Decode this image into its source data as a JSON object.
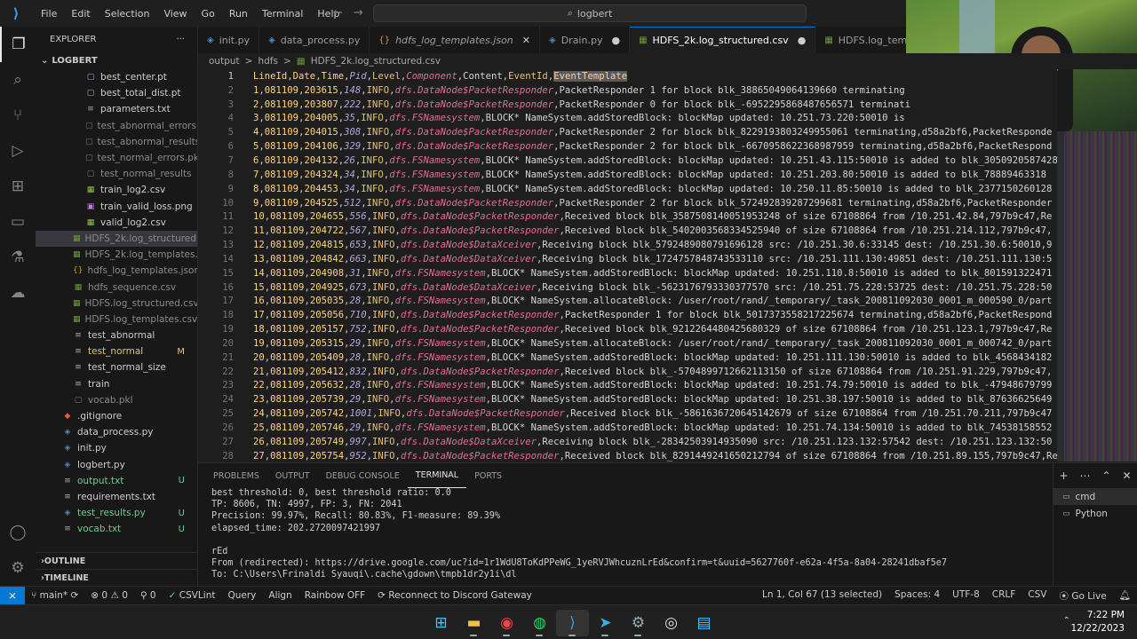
{
  "titlebar": {
    "menu": [
      "File",
      "Edit",
      "Selection",
      "View",
      "Go",
      "Run",
      "Terminal",
      "Help"
    ],
    "search": "logbert"
  },
  "explorer": {
    "header": "EXPLORER",
    "more": "···",
    "root": "LOGBERT",
    "items": [
      {
        "name": "best_center.pt",
        "indent": 2,
        "color": "#cccccc",
        "icon": "file-icon",
        "iconColor": "#9ab",
        "badge": ""
      },
      {
        "name": "best_total_dist.pt",
        "indent": 2,
        "color": "#cccccc",
        "icon": "file-icon",
        "iconColor": "#9ab",
        "badge": ""
      },
      {
        "name": "parameters.txt",
        "indent": 2,
        "color": "#cccccc",
        "icon": "text-file-icon",
        "iconColor": "#aaa",
        "badge": ""
      },
      {
        "name": "test_abnormal_errors.pkl",
        "indent": 2,
        "color": "#8b8b8b",
        "icon": "file-icon",
        "iconColor": "#777",
        "badge": ""
      },
      {
        "name": "test_abnormal_results",
        "indent": 2,
        "color": "#8b8b8b",
        "icon": "file-icon",
        "iconColor": "#777",
        "badge": ""
      },
      {
        "name": "test_normal_errors.pkl",
        "indent": 2,
        "color": "#8b8b8b",
        "icon": "file-icon",
        "iconColor": "#777",
        "badge": ""
      },
      {
        "name": "test_normal_results",
        "indent": 2,
        "color": "#8b8b8b",
        "icon": "file-icon",
        "iconColor": "#777",
        "badge": ""
      },
      {
        "name": "train_log2.csv",
        "indent": 2,
        "color": "#cccccc",
        "icon": "csv-icon",
        "iconColor": "#8bc34a",
        "badge": ""
      },
      {
        "name": "train_valid_loss.png",
        "indent": 2,
        "color": "#cccccc",
        "icon": "image-icon",
        "iconColor": "#c678dd",
        "badge": ""
      },
      {
        "name": "valid_log2.csv",
        "indent": 2,
        "color": "#cccccc",
        "icon": "csv-icon",
        "iconColor": "#8bc34a",
        "badge": ""
      },
      {
        "name": "HDFS_2k.log_structured.c...",
        "indent": 1,
        "color": "#8b8b8b",
        "icon": "csv-icon",
        "iconColor": "#6a9a3a",
        "badge": "",
        "selected": true
      },
      {
        "name": "HDFS_2k.log_templates.c...",
        "indent": 1,
        "color": "#8b8b8b",
        "icon": "csv-icon",
        "iconColor": "#6a9a3a",
        "badge": ""
      },
      {
        "name": "hdfs_log_templates.json",
        "indent": 1,
        "color": "#8b8b8b",
        "icon": "json-icon",
        "iconColor": "#c9a227",
        "badge": ""
      },
      {
        "name": "hdfs_sequence.csv",
        "indent": 1,
        "color": "#8b8b8b",
        "icon": "csv-icon",
        "iconColor": "#6a9a3a",
        "badge": ""
      },
      {
        "name": "HDFS.log_structured.csv",
        "indent": 1,
        "color": "#8b8b8b",
        "icon": "csv-icon",
        "iconColor": "#6a9a3a",
        "badge": ""
      },
      {
        "name": "HDFS.log_templates.csv",
        "indent": 1,
        "color": "#8b8b8b",
        "icon": "csv-icon",
        "iconColor": "#6a9a3a",
        "badge": ""
      },
      {
        "name": "test_abnormal",
        "indent": 1,
        "color": "#cccccc",
        "icon": "lines-icon",
        "iconColor": "#aaa",
        "badge": ""
      },
      {
        "name": "test_normal",
        "indent": 1,
        "color": "#e2c08d",
        "icon": "lines-icon",
        "iconColor": "#aaa",
        "badge": "M"
      },
      {
        "name": "test_normal_size",
        "indent": 1,
        "color": "#cccccc",
        "icon": "lines-icon",
        "iconColor": "#aaa",
        "badge": ""
      },
      {
        "name": "train",
        "indent": 1,
        "color": "#cccccc",
        "icon": "lines-icon",
        "iconColor": "#aaa",
        "badge": ""
      },
      {
        "name": "vocab.pkl",
        "indent": 1,
        "color": "#8b8b8b",
        "icon": "file-icon",
        "iconColor": "#777",
        "badge": ""
      },
      {
        "name": ".gitignore",
        "indent": 0,
        "color": "#cccccc",
        "icon": "git-icon",
        "iconColor": "#e8583a",
        "badge": ""
      },
      {
        "name": "data_process.py",
        "indent": 0,
        "color": "#cccccc",
        "icon": "python-icon",
        "iconColor": "#4b8bbe",
        "badge": ""
      },
      {
        "name": "init.py",
        "indent": 0,
        "color": "#cccccc",
        "icon": "python-icon",
        "iconColor": "#4b8bbe",
        "badge": ""
      },
      {
        "name": "logbert.py",
        "indent": 0,
        "color": "#cccccc",
        "icon": "python-icon",
        "iconColor": "#4b8bbe",
        "badge": ""
      },
      {
        "name": "output.txt",
        "indent": 0,
        "color": "#73c991",
        "icon": "text-file-icon",
        "iconColor": "#aaa",
        "badge": "U"
      },
      {
        "name": "requirements.txt",
        "indent": 0,
        "color": "#cccccc",
        "icon": "text-file-icon",
        "iconColor": "#aaa",
        "badge": ""
      },
      {
        "name": "test_results.py",
        "indent": 0,
        "color": "#73c991",
        "icon": "python-icon",
        "iconColor": "#4b8bbe",
        "badge": "U"
      },
      {
        "name": "vocab.txt",
        "indent": 0,
        "color": "#73c991",
        "icon": "text-file-icon",
        "iconColor": "#aaa",
        "badge": "U"
      }
    ],
    "sections": [
      "OUTLINE",
      "TIMELINE"
    ]
  },
  "tabs": [
    {
      "label": "init.py",
      "icon": "python-icon",
      "iconColor": "#4b8bbe",
      "italic": false,
      "dot": false,
      "close": false,
      "active": false
    },
    {
      "label": "data_process.py",
      "icon": "python-icon",
      "iconColor": "#4b8bbe",
      "italic": false,
      "dot": false,
      "close": false,
      "active": false
    },
    {
      "label": "hdfs_log_templates.json",
      "icon": "json-icon",
      "iconColor": "#c9a227",
      "italic": true,
      "dot": false,
      "close": true,
      "active": false
    },
    {
      "label": "Drain.py",
      "icon": "python-icon",
      "iconColor": "#4b8bbe",
      "italic": false,
      "dot": true,
      "close": false,
      "active": false
    },
    {
      "label": "HDFS_2k.log_structured.csv",
      "icon": "csv-icon",
      "iconColor": "#6a9a3a",
      "italic": false,
      "dot": true,
      "close": false,
      "active": true
    },
    {
      "label": "HDFS.log_templates.c",
      "icon": "csv-icon",
      "iconColor": "#6a9a3a",
      "italic": false,
      "dot": false,
      "close": false,
      "active": false
    }
  ],
  "breadcrumb": [
    "output",
    ">",
    "hdfs",
    ">",
    "HDFS_2k.log_structured.csv"
  ],
  "editor": {
    "header": {
      "ln": "1",
      "fields": [
        "LineId",
        "Date",
        "Time",
        "Pid",
        "Level",
        "Component",
        "Content",
        "EventId"
      ],
      "highlight": "EventTemplate"
    },
    "rows": [
      {
        "ln": "2",
        "id": "1",
        "date": "081109",
        "time": "203615",
        "pid": "148",
        "level": "INFO",
        "comp": "dfs.DataNode$PacketResponder",
        "content": "PacketResponder 1 for block blk_38865049064139660 terminating"
      },
      {
        "ln": "3",
        "id": "2",
        "date": "081109",
        "time": "203807",
        "pid": "222",
        "level": "INFO",
        "comp": "dfs.DataNode$PacketResponder",
        "content": "PacketResponder 0 for block blk_-6952295868487656571 terminati"
      },
      {
        "ln": "4",
        "id": "3",
        "date": "081109",
        "time": "204005",
        "pid": "35",
        "level": "INFO",
        "comp": "dfs.FSNamesystem",
        "content": "BLOCK* NameSystem.addStoredBlock: blockMap updated: 10.251.73.220:50010 is"
      },
      {
        "ln": "5",
        "id": "4",
        "date": "081109",
        "time": "204015",
        "pid": "308",
        "level": "INFO",
        "comp": "dfs.DataNode$PacketResponder",
        "content": "PacketResponder 2 for block blk_8229193803249955061 terminating,d58a2bf6,PacketResponde"
      },
      {
        "ln": "6",
        "id": "5",
        "date": "081109",
        "time": "204106",
        "pid": "329",
        "level": "INFO",
        "comp": "dfs.DataNode$PacketResponder",
        "content": "PacketResponder 2 for block blk_-6670958622368987959 terminating,d58a2bf6,PacketRespond"
      },
      {
        "ln": "7",
        "id": "6",
        "date": "081109",
        "time": "204132",
        "pid": "26",
        "level": "INFO",
        "comp": "dfs.FSNamesystem",
        "content": "BLOCK* NameSystem.addStoredBlock: blockMap updated: 10.251.43.115:50010 is added to blk_3050920587428"
      },
      {
        "ln": "8",
        "id": "7",
        "date": "081109",
        "time": "204324",
        "pid": "34",
        "level": "INFO",
        "comp": "dfs.FSNamesystem",
        "content": "BLOCK* NameSystem.addStoredBlock: blockMap updated: 10.251.203.80:50010 is added to blk_78889463318"
      },
      {
        "ln": "9",
        "id": "8",
        "date": "081109",
        "time": "204453",
        "pid": "34",
        "level": "INFO",
        "comp": "dfs.FSNamesystem",
        "content": "BLOCK* NameSystem.addStoredBlock: blockMap updated: 10.250.11.85:50010 is added to blk_2377150260128"
      },
      {
        "ln": "10",
        "id": "9",
        "date": "081109",
        "time": "204525",
        "pid": "512",
        "level": "INFO",
        "comp": "dfs.DataNode$PacketResponder",
        "content": "PacketResponder 2 for block blk_572492839287299681 terminating,d58a2bf6,PacketResponder"
      },
      {
        "ln": "11",
        "id": "10",
        "date": "081109",
        "time": "204655",
        "pid": "556",
        "level": "INFO",
        "comp": "dfs.DataNode$PacketResponder",
        "content": "Received block blk_3587508140051953248 of size 67108864 from /10.251.42.84,797b9c47,Re"
      },
      {
        "ln": "12",
        "id": "11",
        "date": "081109",
        "time": "204722",
        "pid": "567",
        "level": "INFO",
        "comp": "dfs.DataNode$PacketResponder",
        "content": "Received block blk_5402003568334525940 of size 67108864 from /10.251.214.112,797b9c47,"
      },
      {
        "ln": "13",
        "id": "12",
        "date": "081109",
        "time": "204815",
        "pid": "653",
        "level": "INFO",
        "comp": "dfs.DataNode$DataXceiver",
        "content": "Receiving block blk_5792489080791696128 src: /10.251.30.6:33145 dest: /10.251.30.6:50010,9"
      },
      {
        "ln": "14",
        "id": "13",
        "date": "081109",
        "time": "204842",
        "pid": "663",
        "level": "INFO",
        "comp": "dfs.DataNode$DataXceiver",
        "content": "Receiving block blk_1724757848743533110 src: /10.251.111.130:49851 dest: /10.251.111.130:5"
      },
      {
        "ln": "15",
        "id": "14",
        "date": "081109",
        "time": "204908",
        "pid": "31",
        "level": "INFO",
        "comp": "dfs.FSNamesystem",
        "content": "BLOCK* NameSystem.addStoredBlock: blockMap updated: 10.251.110.8:50010 is added to blk_801591322471"
      },
      {
        "ln": "16",
        "id": "15",
        "date": "081109",
        "time": "204925",
        "pid": "673",
        "level": "INFO",
        "comp": "dfs.DataNode$DataXceiver",
        "content": "Receiving block blk_-5623176793330377570 src: /10.251.75.228:53725 dest: /10.251.75.228:50"
      },
      {
        "ln": "17",
        "id": "16",
        "date": "081109",
        "time": "205035",
        "pid": "28",
        "level": "INFO",
        "comp": "dfs.FSNamesystem",
        "content": "BLOCK* NameSystem.allocateBlock: /user/root/rand/_temporary/_task_200811092030_0001_m_000590_0/part"
      },
      {
        "ln": "18",
        "id": "17",
        "date": "081109",
        "time": "205056",
        "pid": "710",
        "level": "INFO",
        "comp": "dfs.DataNode$PacketResponder",
        "content": "PacketResponder 1 for block blk_5017373558217225674 terminating,d58a2bf6,PacketRespond"
      },
      {
        "ln": "19",
        "id": "18",
        "date": "081109",
        "time": "205157",
        "pid": "752",
        "level": "INFO",
        "comp": "dfs.DataNode$PacketResponder",
        "content": "Received block blk_9212264480425680329 of size 67108864 from /10.251.123.1,797b9c47,Re"
      },
      {
        "ln": "20",
        "id": "19",
        "date": "081109",
        "time": "205315",
        "pid": "29",
        "level": "INFO",
        "comp": "dfs.FSNamesystem",
        "content": "BLOCK* NameSystem.allocateBlock: /user/root/rand/_temporary/_task_200811092030_0001_m_000742_0/part"
      },
      {
        "ln": "21",
        "id": "20",
        "date": "081109",
        "time": "205409",
        "pid": "28",
        "level": "INFO",
        "comp": "dfs.FSNamesystem",
        "content": "BLOCK* NameSystem.addStoredBlock: blockMap updated: 10.251.111.130:50010 is added to blk_4568434182"
      },
      {
        "ln": "22",
        "id": "21",
        "date": "081109",
        "time": "205412",
        "pid": "832",
        "level": "INFO",
        "comp": "dfs.DataNode$PacketResponder",
        "content": "Received block blk_-5704899712662113150 of size 67108864 from /10.251.91.229,797b9c47,"
      },
      {
        "ln": "23",
        "id": "22",
        "date": "081109",
        "time": "205632",
        "pid": "28",
        "level": "INFO",
        "comp": "dfs.FSNamesystem",
        "content": "BLOCK* NameSystem.addStoredBlock: blockMap updated: 10.251.74.79:50010 is added to blk_-47948679799"
      },
      {
        "ln": "24",
        "id": "23",
        "date": "081109",
        "time": "205739",
        "pid": "29",
        "level": "INFO",
        "comp": "dfs.FSNamesystem",
        "content": "BLOCK* NameSystem.addStoredBlock: blockMap updated: 10.251.38.197:50010 is added to blk_87636625649"
      },
      {
        "ln": "25",
        "id": "24",
        "date": "081109",
        "time": "205742",
        "pid": "1001",
        "level": "INFO",
        "comp": "dfs.DataNode$PacketResponder",
        "content": "Received block blk_-5861636720645142679 of size 67108864 from /10.251.70.211,797b9c47"
      },
      {
        "ln": "26",
        "id": "25",
        "date": "081109",
        "time": "205746",
        "pid": "29",
        "level": "INFO",
        "comp": "dfs.FSNamesystem",
        "content": "BLOCK* NameSystem.addStoredBlock: blockMap updated: 10.251.74.134:50010 is added to blk_74538158552"
      },
      {
        "ln": "27",
        "id": "26",
        "date": "081109",
        "time": "205749",
        "pid": "997",
        "level": "INFO",
        "comp": "dfs.DataNode$DataXceiver",
        "content": "Receiving block blk_-28342503914935090 src: /10.251.123.132:57542 dest: /10.251.123.132:50"
      },
      {
        "ln": "28",
        "id": "27",
        "date": "081109",
        "time": "205754",
        "pid": "952",
        "level": "INFO",
        "comp": "dfs.DataNode$PacketResponder",
        "content": "Received block blk_8291449241650212794 of size 67108864 from /10.251.89.155,797b9c47,Re"
      }
    ]
  },
  "panel": {
    "tabs": [
      "PROBLEMS",
      "OUTPUT",
      "DEBUG CONSOLE",
      "TERMINAL",
      "PORTS"
    ],
    "active": "TERMINAL",
    "lines": [
      "best threshold: 0, best threshold ratio: 0.0",
      "TP: 8606, TN: 4997, FP: 3, FN: 2041",
      "Precision: 99.97%, Recall: 80.83%, F1-measure: 89.39%",
      "elapsed_time: 202.2720097421997",
      "",
      "rEd",
      "From (redirected): https://drive.google.com/uc?id=1r1WdU8ToKdPPeWG_1yeRVJWhcuznLrEd&confirm=t&uuid=5627760f-e62a-4f5a-8a04-28241dbaf5e7",
      "To: C:\\Users\\Frinaldi Syauqi\\.cache\\gdown\\tmpb1dr2y1i\\dl"
    ],
    "shells": [
      "cmd",
      "Python"
    ]
  },
  "statusbar": {
    "branch": "main*",
    "sync": "⟳",
    "errors": "⊗ 0 ⚠ 0",
    "ports": "⚲ 0",
    "csvlint": "CSVLint",
    "query": "Query",
    "align": "Align",
    "rainbow": "Rainbow OFF",
    "discord": "Reconnect to Discord Gateway",
    "position": "Ln 1, Col 67 (13 selected)",
    "spaces": "Spaces: 4",
    "encoding": "UTF-8",
    "eol": "CRLF",
    "language": "CSV",
    "golive": "Go Live"
  },
  "taskbar": {
    "time": "7:22 PM",
    "date": "12/22/2023"
  }
}
